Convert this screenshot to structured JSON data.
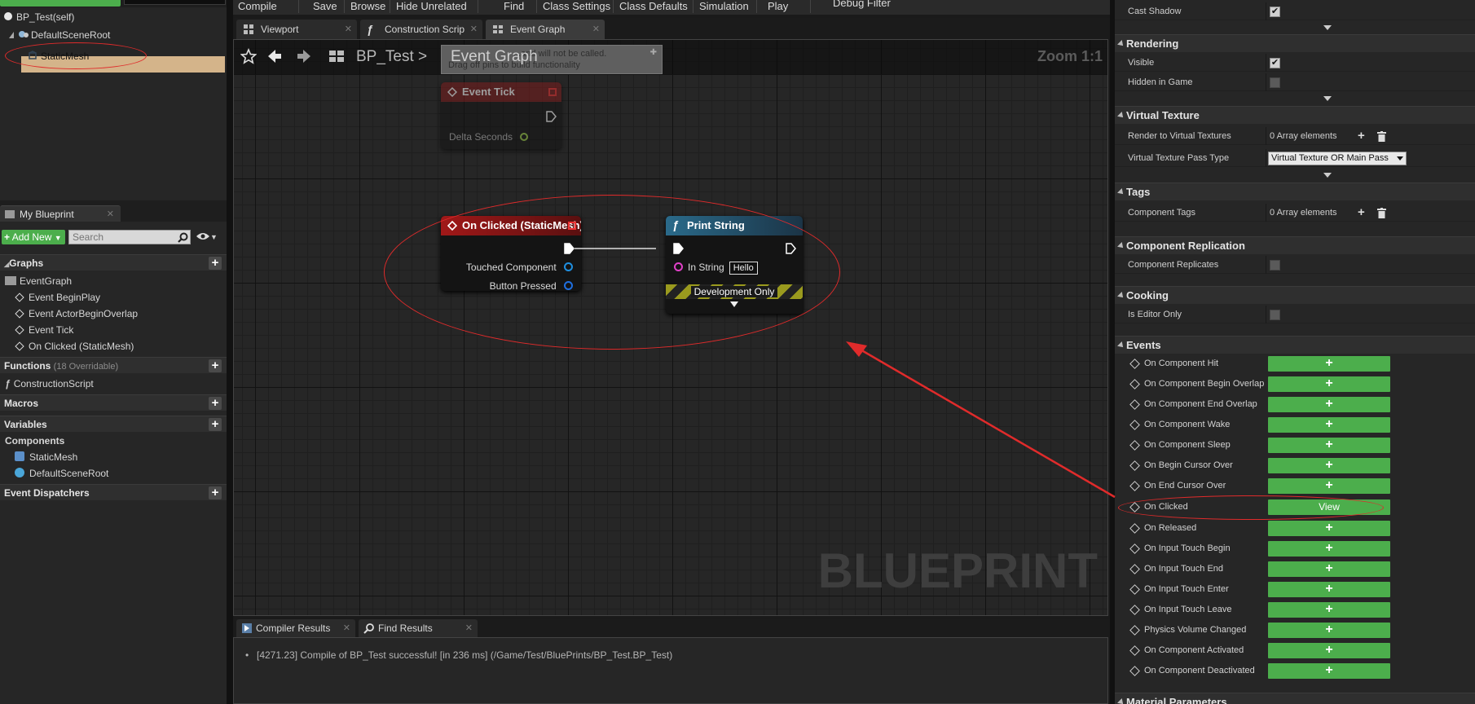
{
  "left_panel": {
    "tree": {
      "self_label": "BP_Test(self)",
      "root_label": "DefaultSceneRoot",
      "selected_label": "StaticMesh"
    },
    "my_blueprint_tab": "My Blueprint",
    "add_new_label": "Add New",
    "search_placeholder": "Search",
    "graphs_header": "Graphs",
    "event_graph_label": "EventGraph",
    "graph_events": [
      "Event BeginPlay",
      "Event ActorBeginOverlap",
      "Event Tick",
      "On Clicked (StaticMesh)"
    ],
    "functions_header": "Functions",
    "functions_sub": "(18 Overridable)",
    "construction_script": "ConstructionScript",
    "macros_header": "Macros",
    "variables_header": "Variables",
    "components_header": "Components",
    "components": [
      "StaticMesh",
      "DefaultSceneRoot"
    ],
    "event_dispatchers_header": "Event Dispatchers"
  },
  "toolbar": {
    "items": [
      "Compile",
      "Save",
      "Browse",
      "Hide Unrelated",
      "Find",
      "Class Settings",
      "Class Defaults",
      "Simulation",
      "Play",
      "Debug Filter"
    ]
  },
  "editor_tabs": [
    "Viewport",
    "Construction Scrip",
    "Event Graph"
  ],
  "graph": {
    "breadcrumb_root": "BP_Test",
    "breadcrumb_sep": ">",
    "breadcrumb_current": "Event Graph",
    "zoom": "Zoom 1:1",
    "tooltip_line1": "...and will not be called.",
    "tooltip_line2": "Drag off pins to build functionality",
    "watermark": "BLUEPRINT",
    "event_tick_node": {
      "title": "Event Tick",
      "pin": "Delta Seconds"
    },
    "on_clicked_node": {
      "title": "On Clicked (StaticMesh)",
      "pin1": "Touched Component",
      "pin2": "Button Pressed"
    },
    "print_string_node": {
      "title": "Print String",
      "in_string_label": "In String",
      "in_string_value": "Hello",
      "dev_only": "Development Only"
    }
  },
  "bottom_tabs": [
    "Compiler Results",
    "Find Results"
  ],
  "compiler_log": "[4271.23] Compile of BP_Test successful! [in 236 ms] (/Game/Test/BluePrints/BP_Test.BP_Test)",
  "details": {
    "cast_shadow_label": "Cast Shadow",
    "rendering_header": "Rendering",
    "visible_label": "Visible",
    "hidden_in_game_label": "Hidden in Game",
    "virtual_texture_header": "Virtual Texture",
    "render_to_vt_label": "Render to Virtual Textures",
    "array_elements": "0 Array elements",
    "vt_pass_type_label": "Virtual Texture Pass Type",
    "vt_pass_type_value": "Virtual Texture OR Main Pass",
    "tags_header": "Tags",
    "component_tags_label": "Component Tags",
    "component_replication_header": "Component Replication",
    "component_replicates_label": "Component Replicates",
    "cooking_header": "Cooking",
    "is_editor_only_label": "Is Editor Only",
    "events_header": "Events",
    "events": [
      "On Component Hit",
      "On Component Begin Overlap",
      "On Component End Overlap",
      "On Component Wake",
      "On Component Sleep",
      "On Begin Cursor Over",
      "On End Cursor Over",
      "On Clicked",
      "On Released",
      "On Input Touch Begin",
      "On Input Touch End",
      "On Input Touch Enter",
      "On Input Touch Leave",
      "Physics Volume Changed",
      "On Component Activated",
      "On Component Deactivated"
    ],
    "add_symbol": "+",
    "view_label": "View",
    "material_parameters_header": "Material Parameters"
  },
  "colors": {
    "accent_green": "#4cae4c",
    "annotation_red": "#e02b2b",
    "event_node_header": "#8a1414",
    "function_node_header": "#1f4a63"
  }
}
